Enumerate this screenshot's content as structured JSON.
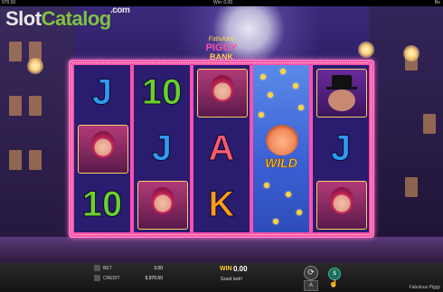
{
  "topbar": {
    "left_value": "970.50",
    "center_label": "Win: 0.00",
    "right_value": "Be"
  },
  "watermark": {
    "slot": "Slot",
    "catalog": "Catalog",
    "dotcom": ".com"
  },
  "game_logo": {
    "line1": "Fabulous",
    "line2": "PIGGY",
    "line3": "BANK"
  },
  "reels": [
    {
      "symbols": [
        {
          "type": "card",
          "text": "J",
          "color": "blue"
        },
        {
          "type": "lady"
        },
        {
          "type": "card",
          "text": "10",
          "color": "green"
        }
      ]
    },
    {
      "symbols": [
        {
          "type": "card",
          "text": "10",
          "color": "green"
        },
        {
          "type": "card",
          "text": "J",
          "color": "blue"
        },
        {
          "type": "lady"
        }
      ]
    },
    {
      "symbols": [
        {
          "type": "lady"
        },
        {
          "type": "card",
          "text": "A",
          "color": "red"
        },
        {
          "type": "card",
          "text": "K",
          "color": "orange"
        }
      ]
    },
    {
      "wild": true,
      "wild_label": "WILD"
    },
    {
      "symbols": [
        {
          "type": "boss"
        },
        {
          "type": "card",
          "text": "J",
          "color": "blue"
        },
        {
          "type": "lady"
        }
      ]
    }
  ],
  "balance": {
    "bet_label": "BET",
    "bet_value": "3.00",
    "credit_label": "CREDIT",
    "credit_value": "9,970.50"
  },
  "win": {
    "label": "WIN",
    "value": "0.00",
    "message": "Good luck!"
  },
  "controls": {
    "spin_symbol": "⟳",
    "auto_label": "A",
    "chip_label": "$",
    "hand_symbol": "☝"
  },
  "footer": {
    "game_name": "Fabulous Piggy"
  },
  "colors": {
    "frame": "#ff4fb0",
    "accent_win": "#ffcc2a",
    "logo_green": "#7fc241"
  }
}
